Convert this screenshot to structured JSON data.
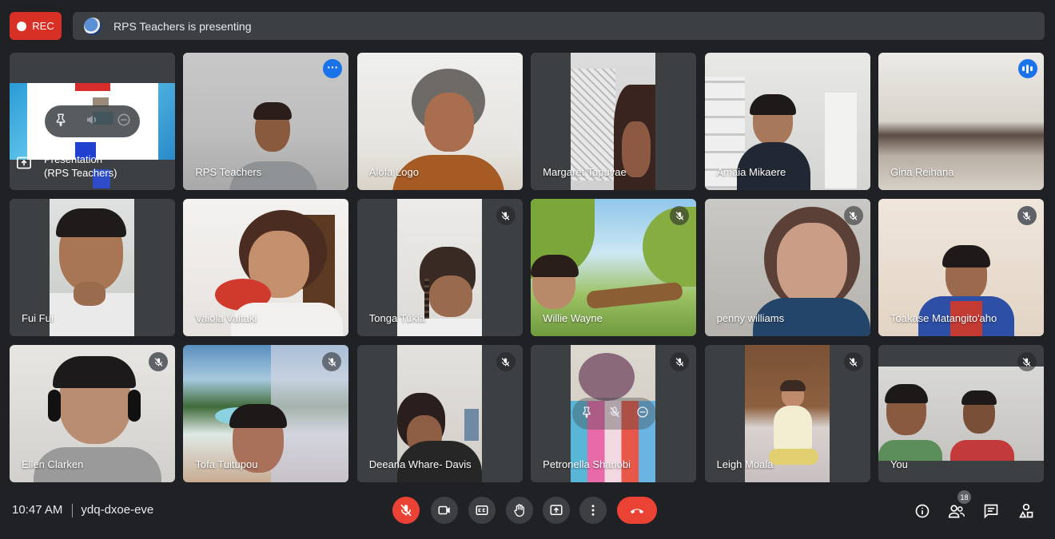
{
  "top": {
    "rec_label": "REC",
    "presenting_text": "RPS Teachers is presenting"
  },
  "presentation_tile": {
    "line1": "Presentation",
    "line2": "(RPS Teachers)"
  },
  "participants": [
    {
      "name": "RPS Teachers",
      "muted": false
    },
    {
      "name": "Alofa Logo",
      "muted": false
    },
    {
      "name": "Margaret Tapuvae",
      "muted": false
    },
    {
      "name": "Amaia Mikaere",
      "muted": false
    },
    {
      "name": "Gina Reihana",
      "muted": false,
      "speaking": true
    },
    {
      "name": "Fui Fui",
      "muted": false
    },
    {
      "name": "Vaiola Vaitaki",
      "muted": false
    },
    {
      "name": "Tonga Tukia",
      "muted": true
    },
    {
      "name": "Willie Wayne",
      "muted": true
    },
    {
      "name": "penny williams",
      "muted": true
    },
    {
      "name": "Toakase Matangito'aho",
      "muted": true
    },
    {
      "name": "Ellen Clarken",
      "muted": true
    },
    {
      "name": "Tofa Tuitupou",
      "muted": true
    },
    {
      "name": "Deeana Whare- Davis",
      "muted": true
    },
    {
      "name": "Petronella Shanobi",
      "muted": true
    },
    {
      "name": "Leigh Moala",
      "muted": true
    },
    {
      "name": "You",
      "muted": true
    }
  ],
  "bottom": {
    "time": "10:47 AM",
    "meeting_code": "ydq-dxoe-eve",
    "participant_count": "18"
  },
  "icons": [
    "rec-dot-icon",
    "present-icon",
    "pin-icon",
    "volume-icon",
    "remove-icon",
    "mic-off-icon",
    "camera-icon",
    "captions-icon",
    "raise-hand-icon",
    "present-now-icon",
    "more-options-icon",
    "end-call-icon",
    "info-icon",
    "people-icon",
    "chat-icon",
    "activities-icon"
  ],
  "colors": {
    "background": "#202124",
    "tile": "#3c4043",
    "accent": "#1a73e8",
    "danger": "#ea4335"
  }
}
